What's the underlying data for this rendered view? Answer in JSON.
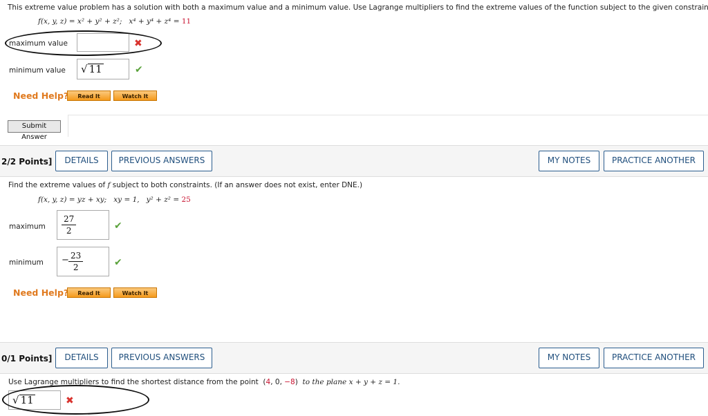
{
  "q1": {
    "prompt": "This extreme value problem has a solution with both a maximum value and a minimum value. Use Lagrange multipliers to find the extreme values of the function subject to the given constraint.",
    "function": "f(x, y, z) = x² + y² + z²;",
    "constraint_lhs": "x⁴ + y⁴ + z⁴ =",
    "constraint_rhs": "11",
    "max_label": "maximum value",
    "min_label": "minimum value",
    "min_answer": "11",
    "need_help": "Need Help?",
    "read_it": "Read It",
    "watch_it": "Watch It",
    "submit": "Submit Answer"
  },
  "q2": {
    "points": "2/2 Points]",
    "details": "DETAILS",
    "previous_answers": "PREVIOUS ANSWERS",
    "my_notes": "MY NOTES",
    "practice_another": "PRACTICE ANOTHER",
    "prompt_pre": "Find the extreme values of ",
    "prompt_f": "f",
    "prompt_post": " subject to both constraints. (If an answer does not exist, enter DNE.)",
    "function": "f(x, y, z) = yz + xy;",
    "constraint1": "xy = 1,",
    "constraint2_lhs": "y² + z² =",
    "constraint2_rhs": "25",
    "max_label": "maximum",
    "min_label": "minimum",
    "max_num": "27",
    "max_den": "2",
    "min_sign": "−",
    "min_num": "23",
    "min_den": "2",
    "need_help": "Need Help?",
    "read_it": "Read It",
    "watch_it": "Watch It"
  },
  "q3": {
    "points": "0/1 Points]",
    "details": "DETAILS",
    "previous_answers": "PREVIOUS ANSWERS",
    "my_notes": "MY NOTES",
    "practice_another": "PRACTICE ANOTHER",
    "prompt": "Use Lagrange multipliers to find the shortest distance from the point",
    "point_open": "(",
    "p1": "4",
    "sep1": ", 0, ",
    "p3": "−8",
    "point_close": ")",
    "prompt_tail": "to the plane  x + y + z = 1.",
    "answer": "11"
  },
  "colors": {
    "accent": "#2b5d8e",
    "help": "#e07a1f",
    "correct": "#5aa23b",
    "incorrect": "#d9332e",
    "highlight": "#c8102e"
  }
}
